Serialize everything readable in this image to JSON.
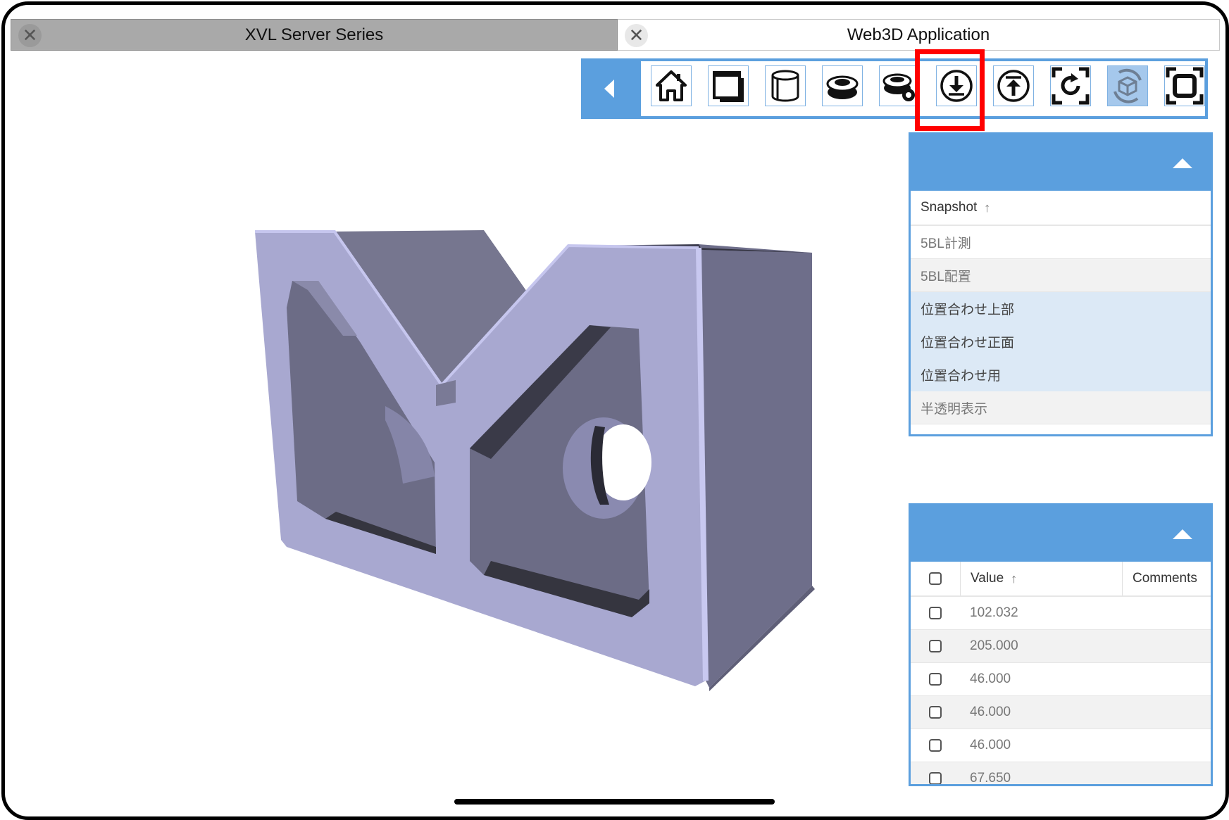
{
  "tabs": [
    {
      "title": "XVL Server Series",
      "close": "✕",
      "active": false
    },
    {
      "title": "Web3D Application",
      "close": "✕",
      "active": true
    }
  ],
  "toolbar": {
    "collapse_icon": "chevron-left-icon",
    "buttons": [
      {
        "icon": "home-icon"
      },
      {
        "icon": "window-icon"
      },
      {
        "icon": "cylinder-icon"
      },
      {
        "icon": "disk-icon"
      },
      {
        "icon": "disk-settings-icon"
      },
      {
        "icon": "download-icon",
        "highlighted": true
      },
      {
        "icon": "upload-icon"
      },
      {
        "icon": "rotate-fit-icon"
      },
      {
        "icon": "rotate-3d-icon",
        "active": true
      },
      {
        "icon": "fullscreen-icon"
      }
    ]
  },
  "snapshot_panel": {
    "header": "Snapshot",
    "sort_icon": "↑",
    "rows": [
      {
        "label": "5BL計測"
      },
      {
        "label": "5BL配置"
      },
      {
        "label": "位置合わせ上部"
      },
      {
        "label": "位置合わせ正面"
      },
      {
        "label": "位置合わせ用"
      },
      {
        "label": "半透明表示"
      }
    ]
  },
  "measure_panel": {
    "value_header": "Value",
    "sort_icon": "↑",
    "comments_header": "Comments",
    "rows": [
      {
        "value": "102.032"
      },
      {
        "value": "205.000"
      },
      {
        "value": "46.000"
      },
      {
        "value": "46.000"
      },
      {
        "value": "46.000"
      },
      {
        "value": "67.650"
      }
    ]
  },
  "colors": {
    "accent": "#5b9fde",
    "highlight": "#ff0000",
    "model_face": "#a6a6d0",
    "model_side": "#6e6e8a"
  }
}
